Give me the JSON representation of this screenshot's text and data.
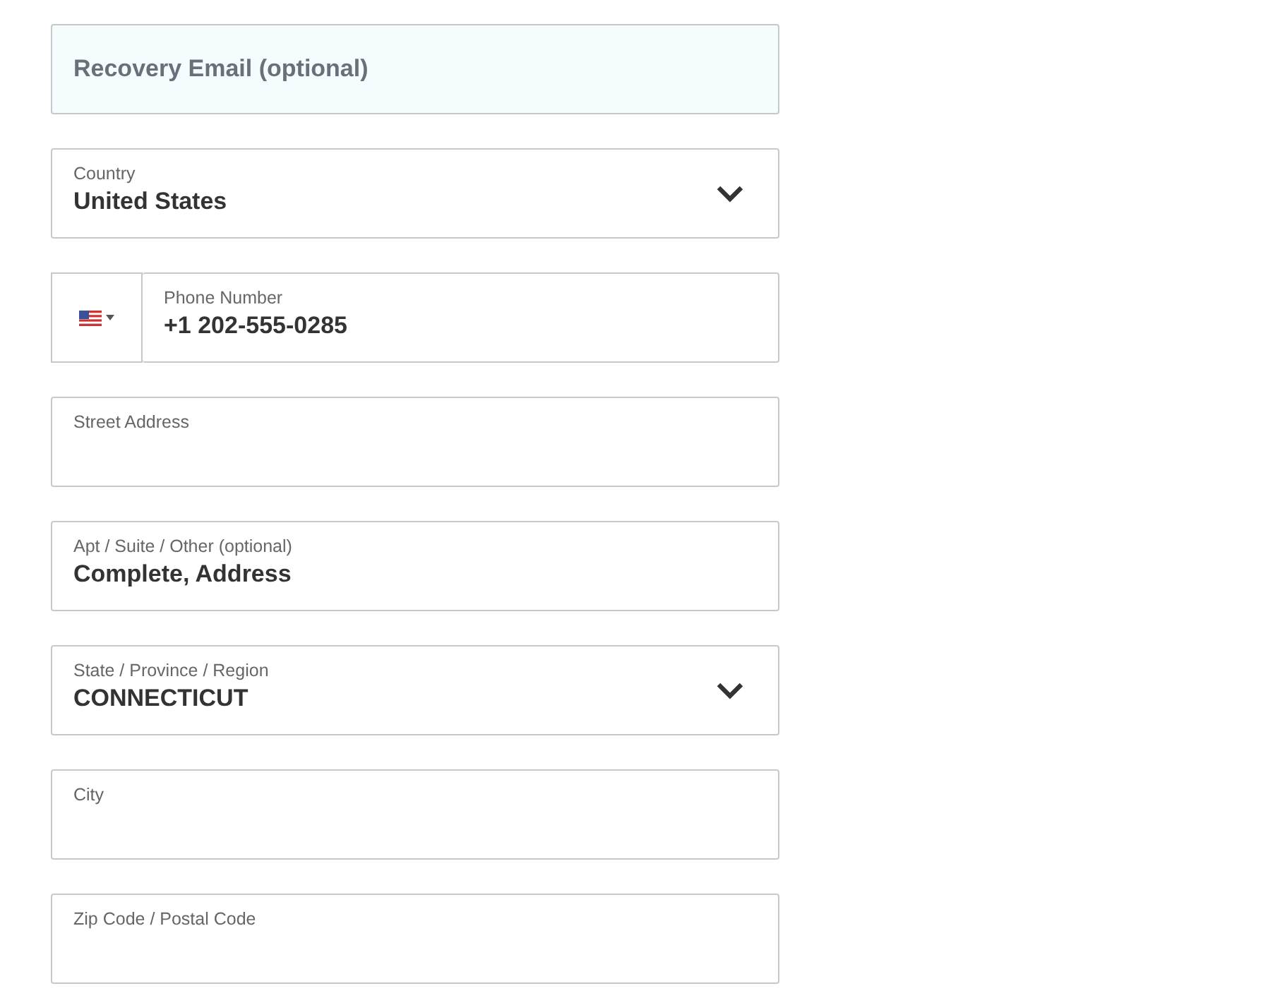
{
  "fields": [
    {
      "kind": "email",
      "placeholder": "Recovery Email (optional)"
    },
    {
      "kind": "select",
      "label": "Country",
      "value": "United States"
    },
    {
      "kind": "phone",
      "label": "Phone Number",
      "value": "+1 202-555-0285"
    },
    {
      "kind": "text",
      "label": "Street Address"
    },
    {
      "kind": "text",
      "label": "Apt / Suite / Other (optional)",
      "value": "Complete, Address"
    },
    {
      "kind": "select",
      "label": "State / Province / Region",
      "value": "CONNECTICUT"
    },
    {
      "kind": "text",
      "label": "City"
    },
    {
      "kind": "text",
      "label": "Zip Code / Postal Code"
    }
  ]
}
